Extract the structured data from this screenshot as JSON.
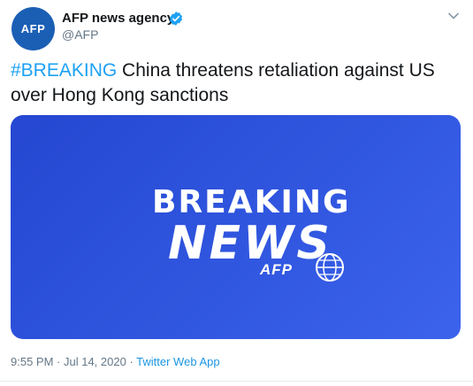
{
  "author": {
    "avatar_text": "AFP",
    "name": "AFP news agency",
    "handle": "@AFP"
  },
  "tweet": {
    "hashtag": "#BREAKING",
    "text": " China threatens retaliation against US over Hong Kong sanctions"
  },
  "media": {
    "line1": "BREAKING",
    "line2": "NEWS",
    "logo": "AFP"
  },
  "meta": {
    "time": "9:55 PM",
    "separator": " · ",
    "date": "Jul 14, 2020",
    "source": "Twitter Web App"
  },
  "colors": {
    "link": "#1da1f2",
    "brand_blue": "#2f55de",
    "verified": "#1da1f2"
  },
  "icons": {
    "verified": "verified-badge-icon",
    "chevron": "chevron-down-icon"
  }
}
